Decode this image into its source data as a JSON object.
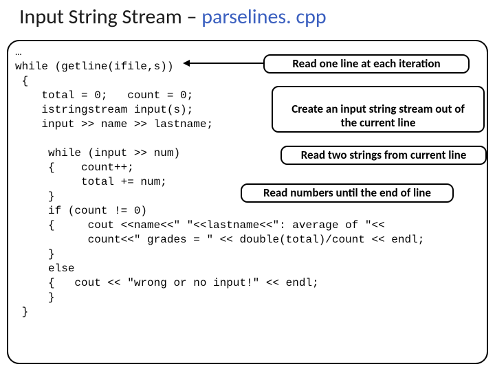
{
  "title_plain": "Input String Stream – ",
  "title_emph": "parselines. cpp",
  "code_text": "…\nwhile (getline(ifile,s))\n {\n    total = 0;   count = 0;\n    istringstream input(s);\n    input >> name >> lastname;\n\n     while (input >> num)\n     {    count++;\n          total += num;\n     }\n     if (count != 0)\n     {     cout <<name<<\" \"<<lastname<<\": average of \"<<\n           count<<\" grades = \" << double(total)/count << endl;\n     }\n     else\n     {   cout << \"wrong or no input!\" << endl;\n     }\n }",
  "callouts": {
    "c1": "Read one line at each iteration",
    "c2": "Create an input string stream out of\nthe current line",
    "c3": "Read two strings from current line",
    "c4": "Read numbers until the end of line"
  }
}
